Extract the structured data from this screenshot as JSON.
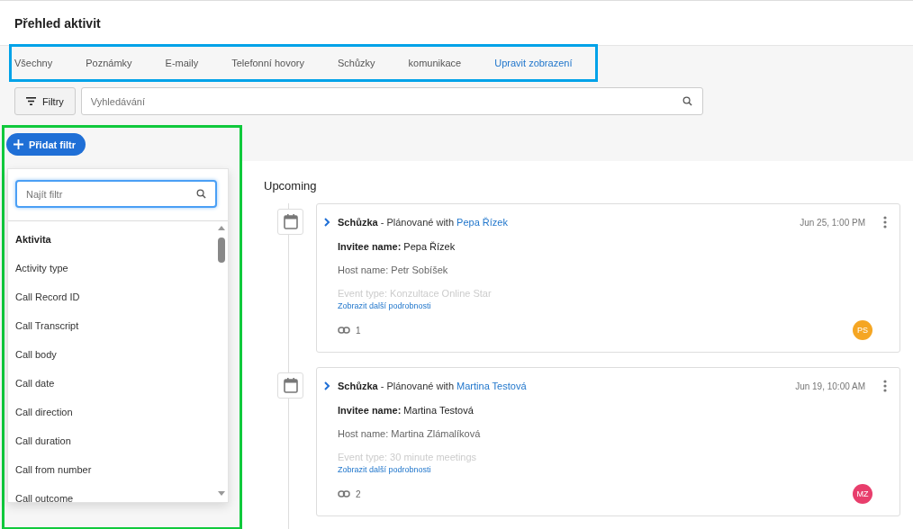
{
  "page": {
    "title": "Přehled aktivit"
  },
  "tabs": [
    {
      "label": "Všechny",
      "kind": "tab",
      "selected": false
    },
    {
      "label": "Poznámky",
      "kind": "tab",
      "selected": false
    },
    {
      "label": "E-maily",
      "kind": "tab",
      "selected": false
    },
    {
      "label": "Telefonní hovory",
      "kind": "tab",
      "selected": false
    },
    {
      "label": "Schůzky",
      "kind": "tab",
      "selected": false
    },
    {
      "label": "komunikace",
      "kind": "tab",
      "selected": false
    },
    {
      "label": "Upravit zobrazení",
      "kind": "link",
      "selected": false
    }
  ],
  "tabs_highlight": {
    "color": "#00a2e8"
  },
  "toolbar": {
    "filter_button": "Filtry",
    "search": {
      "placeholder": "Vyhledávání"
    }
  },
  "filter_panel": {
    "highlight": {
      "color": "#10c93c"
    },
    "add_button": "Přidat filtr",
    "search": {
      "placeholder": "Najít filtr"
    },
    "items": [
      {
        "label": "Aktivita",
        "kind": "heading"
      },
      {
        "label": "Activity type",
        "kind": "option"
      },
      {
        "label": "Call Record ID",
        "kind": "option"
      },
      {
        "label": "Call Transcript",
        "kind": "option"
      },
      {
        "label": "Call body",
        "kind": "option"
      },
      {
        "label": "Call date",
        "kind": "option"
      },
      {
        "label": "Call direction",
        "kind": "option"
      },
      {
        "label": "Call duration",
        "kind": "option"
      },
      {
        "label": "Call from number",
        "kind": "option"
      },
      {
        "label": "Call outcome",
        "kind": "option"
      }
    ]
  },
  "timeline": {
    "section": "Upcoming",
    "items": [
      {
        "type": "Schůzka",
        "status": " - Plánované with ",
        "contact": "Pepa Řízek",
        "time": "Jun 25, 1:00 PM",
        "invitee_label": "Invitee name:",
        "invitee": "Pepa Řízek",
        "host": "Host name: Petr Sobíšek",
        "event": "Event type: Konzultace Online Star",
        "more": "Zobrazit další podrobnosti",
        "links": "1",
        "avatar": "PS",
        "color": "#f5a623"
      },
      {
        "type": "Schůzka",
        "status": " - Plánované with ",
        "contact": "Martina Testová",
        "time": "Jun 19, 10:00 AM",
        "invitee_label": "Invitee name:",
        "invitee": "Martina Testová",
        "host": "Host name: Martina Zlámalíková",
        "event": "Event type: 30 minute meetings",
        "more": "Zobrazit další podrobnosti",
        "links": "2",
        "avatar": "MZ",
        "color": "#e83e6c"
      }
    ]
  }
}
